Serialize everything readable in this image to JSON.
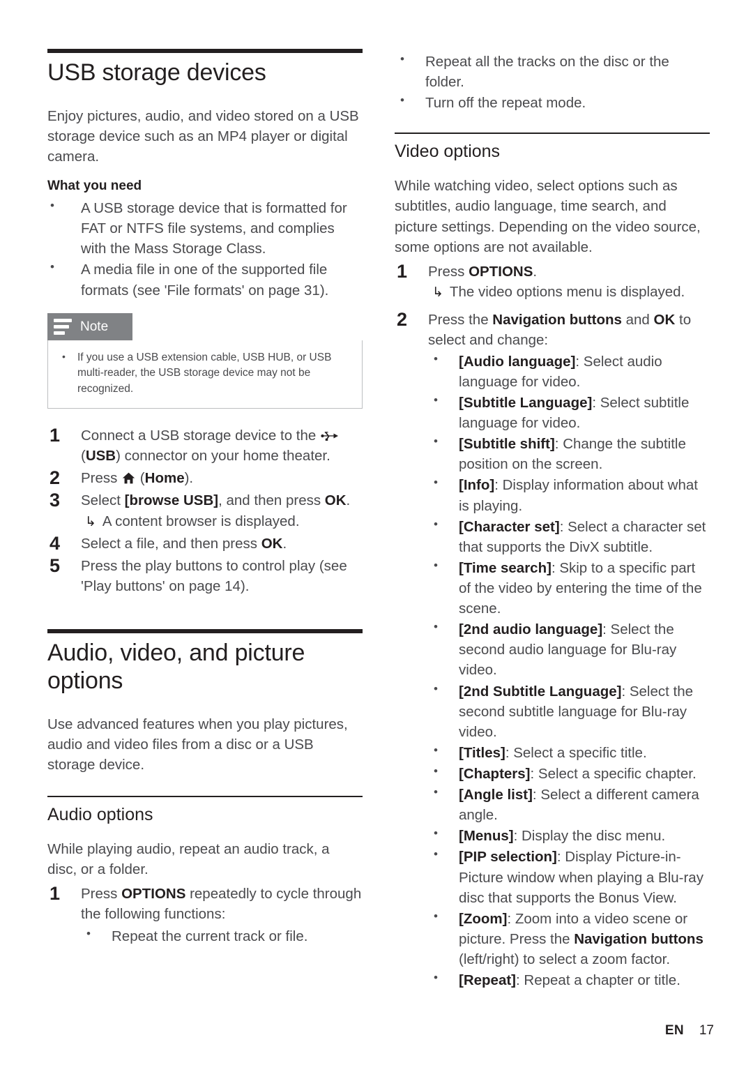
{
  "left_column": {
    "chapter_title": "USB storage devices",
    "intro": "Enjoy pictures, audio, and video stored on a USB storage device such as an MP4 player or digital camera.",
    "what_you_need_heading": "What you need",
    "what_you_need_items": [
      "A USB storage device that is formatted for FAT or NTFS file systems, and complies with the Mass Storage Class.",
      "A media file in one of the supported file formats (see 'File formats' on page 31)."
    ],
    "note": {
      "title": "Note",
      "icon": "note-lines-icon",
      "items": [
        "If you use a USB extension cable, USB HUB, or USB multi-reader, the USB storage device may not be recognized."
      ]
    },
    "steps": [
      {
        "text_before": "Connect a USB storage device to the ",
        "icon": "usb-icon",
        "text_after_icon": " (",
        "bold_mid": "USB",
        "text_end": ") connector on your home theater."
      },
      {
        "text_before": "Press ",
        "icon": "home-icon",
        "text_after_icon": " (",
        "bold_mid": "Home",
        "text_end": ")."
      },
      {
        "text_before": "Select ",
        "bold_mid": "[browse USB]",
        "text_end": ", and then press ",
        "bold_end": "OK",
        "text_tail": ".",
        "result": "A content browser is displayed."
      },
      {
        "text_before": "Select a file, and then press ",
        "bold_end": "OK",
        "text_tail": "."
      },
      {
        "text_before": "Press the play buttons to control play (see 'Play buttons' on page 14)."
      }
    ],
    "section2_title": "Audio, video, and picture options",
    "section2_intro": "Use advanced features when you play pictures, audio and video files from a disc or a USB storage device.",
    "audio_options": {
      "heading": "Audio options",
      "intro": "While playing audio, repeat an audio track, a disc, or a folder.",
      "step_before": "Press ",
      "step_bold": "OPTIONS",
      "step_after": " repeatedly to cycle through the following functions:",
      "functions": [
        "Repeat the current track or file."
      ]
    }
  },
  "right_column": {
    "continued_functions": [
      "Repeat all the tracks on the disc or the folder.",
      "Turn off the repeat mode."
    ],
    "video_options": {
      "heading": "Video options",
      "intro": "While watching video, select options such as subtitles, audio language, time search, and picture settings. Depending on the video source, some options are not available.",
      "step1_before": "Press ",
      "step1_bold": "OPTIONS",
      "step1_after": ".",
      "step1_result": "The video options menu is displayed.",
      "step2_before": "Press the ",
      "step2_bold1": "Navigation buttons",
      "step2_mid": " and ",
      "step2_bold2": "OK",
      "step2_after": " to select and change:",
      "options": [
        {
          "term": "[Audio language]",
          "desc": ": Select audio language for video."
        },
        {
          "term": "[Subtitle Language]",
          "desc": ": Select subtitle language for video."
        },
        {
          "term": "[Subtitle shift]",
          "desc": ": Change the subtitle position on the screen."
        },
        {
          "term": "[Info]",
          "desc": ": Display information about what is playing."
        },
        {
          "term": "[Character set]",
          "desc": ": Select a character set that supports the DivX subtitle."
        },
        {
          "term": "[Time search]",
          "desc": ": Skip to a specific part of the video by entering the time of the scene."
        },
        {
          "term": "[2nd audio language]",
          "desc": ": Select the second audio language for Blu-ray video."
        },
        {
          "term": "[2nd Subtitle Language]",
          "desc": ": Select the second subtitle language for Blu-ray video."
        },
        {
          "term": "[Titles]",
          "desc": ": Select a specific title."
        },
        {
          "term": "[Chapters]",
          "desc": ": Select a specific chapter."
        },
        {
          "term": "[Angle list]",
          "desc": ": Select a different camera angle."
        },
        {
          "term": "[Menus]",
          "desc": ": Display the disc menu."
        },
        {
          "term": "[PIP selection]",
          "desc": ": Display Picture-in-Picture window when playing a Blu-ray disc that supports the Bonus View."
        },
        {
          "term": "[Zoom]",
          "desc": ": Zoom into a video scene or picture. Press the ",
          "desc_bold": "Navigation buttons",
          "desc_tail": " (left/right) to select a zoom factor."
        },
        {
          "term": "[Repeat]",
          "desc": ": Repeat a chapter or title."
        }
      ]
    }
  },
  "footer": {
    "language": "EN",
    "page_number": "17"
  },
  "colors": {
    "rule": "#231f20",
    "body_text": "#4a4a4d",
    "note_header_bg": "#808285",
    "note_border": "#bcbec0"
  }
}
